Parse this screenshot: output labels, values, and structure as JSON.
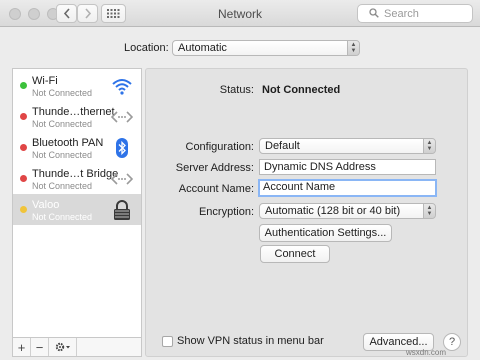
{
  "window": {
    "title": "Network",
    "search_placeholder": "Search",
    "icons": [
      "close-light",
      "minimize-light",
      "zoom-light",
      "back-chevron-icon",
      "forward-chevron-icon",
      "grid-icon",
      "search-icon"
    ]
  },
  "location": {
    "label": "Location:",
    "value": "Automatic"
  },
  "services": [
    {
      "name": "Wi-Fi",
      "status": "Not Connected",
      "dot_color": "#3cc13b",
      "icon": "wifi-icon",
      "selected": false
    },
    {
      "name": "Thunde…thernet",
      "status": "Not Connected",
      "dot_color": "#e04646",
      "icon": "ethernet-arrows-icon",
      "selected": false
    },
    {
      "name": "Bluetooth PAN",
      "status": "Not Connected",
      "dot_color": "#e04646",
      "icon": "bluetooth-icon",
      "selected": false
    },
    {
      "name": "Thunde…t Bridge",
      "status": "Not Connected",
      "dot_color": "#e04646",
      "icon": "ethernet-arrows-icon",
      "selected": false
    },
    {
      "name": "Valoo",
      "status": "Not Connected",
      "dot_color": "#f0c43a",
      "icon": "vpn-lock-icon",
      "selected": true
    }
  ],
  "sidebar_actions": {
    "add": "+",
    "remove": "−",
    "gear": "gear-icon"
  },
  "detail": {
    "status_label": "Status:",
    "status_value": "Not Connected",
    "configuration_label": "Configuration:",
    "configuration_value": "Default",
    "server_label": "Server Address:",
    "server_value": "Dynamic DNS Address",
    "account_label": "Account Name:",
    "account_value": "Account Name",
    "encryption_label": "Encryption:",
    "encryption_value": "Automatic (128 bit or 40 bit)",
    "auth_button": "Authentication Settings...",
    "connect_button": "Connect",
    "show_vpn_label": "Show VPN status in menu bar",
    "show_vpn_checked": false,
    "advanced_button": "Advanced...",
    "help_button": "?"
  },
  "watermark": "wsxdn.com",
  "colors": {
    "accent_blue": "#2e73e8",
    "connected_green": "#3cc13b",
    "error_red": "#e04646",
    "pending_yellow": "#f0c43a"
  }
}
